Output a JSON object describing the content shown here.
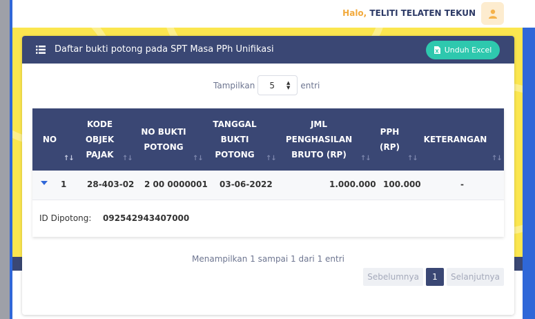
{
  "header": {
    "greeting": "Halo,",
    "user_name": "TELITI TELATEN TEKUN"
  },
  "card": {
    "title": "Daftar bukti potong pada SPT Masa PPh Unifikasi",
    "export_label": "Unduh Excel"
  },
  "length_menu": {
    "prefix": "Tampilkan",
    "selected": "5",
    "suffix": "entri"
  },
  "table": {
    "columns": [
      {
        "line1": "NO",
        "line2": "",
        "line3": ""
      },
      {
        "line1": "KODE",
        "line2": "OBJEK",
        "line3": "PAJAK"
      },
      {
        "line1": "NO BUKTI",
        "line2": "POTONG",
        "line3": ""
      },
      {
        "line1": "TANGGAL",
        "line2": "BUKTI",
        "line3": "POTONG"
      },
      {
        "line1": "JML",
        "line2": "PENGHASILAN",
        "line3": "BRUTO (RP)"
      },
      {
        "line1": "PPH",
        "line2": "(RP)",
        "line3": ""
      },
      {
        "line1": "KETERANGAN",
        "line2": "",
        "line3": ""
      }
    ],
    "sort_glyph": "↑↓",
    "rows": [
      {
        "no": "1",
        "kode": "28-403-02",
        "no_bukti": "2 00 0000001",
        "tanggal": "03-06-2022",
        "bruto": "1.000.000",
        "pph": "100.000",
        "keterangan": "-",
        "detail_label": "ID Dipotong:",
        "detail_value": "092542943407000"
      }
    ]
  },
  "footer": {
    "info": "Menampilkan 1 sampai 1 dari 1 entri",
    "prev": "Sebelumnya",
    "current_page": "1",
    "next": "Selanjutnya"
  },
  "colors": {
    "navy": "#3a4774",
    "accent_green": "#2ec8ae",
    "greeting_orange": "#f2a93b",
    "banner_yellow": "#fbe64f",
    "frame_blue": "#2f67d8"
  }
}
